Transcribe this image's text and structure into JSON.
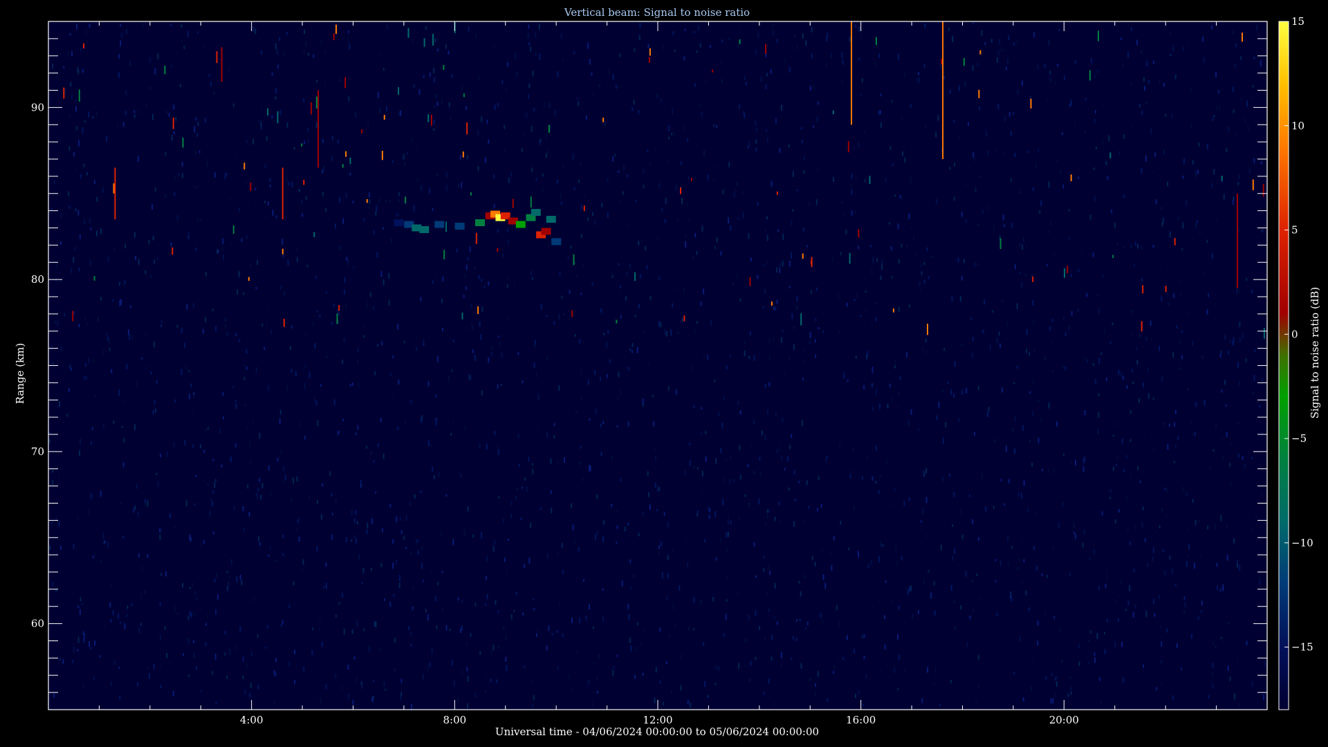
{
  "chart_data": {
    "type": "heatmap",
    "title": "Vertical beam: Signal to noise ratio",
    "xlabel": "Universal time - 04/06/2024 00:00:00 to 05/06/2024 00:00:00",
    "ylabel": "Range (km)",
    "colorbar_label": "Signal to noise ratio (dB)",
    "x_unit": "hours UT",
    "xlim": [
      0,
      24
    ],
    "ylim": [
      55,
      95
    ],
    "clim": [
      -18,
      15
    ],
    "x_ticks": [
      {
        "value": 4,
        "label": "4:00"
      },
      {
        "value": 8,
        "label": "8:00"
      },
      {
        "value": 12,
        "label": "12:00"
      },
      {
        "value": 16,
        "label": "16:00"
      },
      {
        "value": 20,
        "label": "20:00"
      }
    ],
    "y_ticks": [
      {
        "value": 60,
        "label": "60"
      },
      {
        "value": 70,
        "label": "70"
      },
      {
        "value": 80,
        "label": "80"
      },
      {
        "value": 90,
        "label": "90"
      }
    ],
    "colorbar_ticks": [
      {
        "value": 15,
        "label": "15"
      },
      {
        "value": 10,
        "label": "10"
      },
      {
        "value": 5,
        "label": "5"
      },
      {
        "value": 0,
        "label": "0"
      },
      {
        "value": -5,
        "label": "−5"
      },
      {
        "value": -10,
        "label": "−10"
      },
      {
        "value": -15,
        "label": "−15"
      }
    ],
    "background_level_db": -17,
    "colormap": [
      "#000033",
      "#00105a",
      "#003a78",
      "#006a6a",
      "#008040",
      "#00a000",
      "#407000",
      "#a00000",
      "#dd2200",
      "#ff7a00",
      "#ffc000",
      "#ffff40"
    ],
    "echo_layer": {
      "time_range": [
        6.8,
        10.2
      ],
      "range_km": [
        82,
        84.5
      ],
      "cells": [
        {
          "t": 6.9,
          "r": 83.3,
          "v": -14
        },
        {
          "t": 7.1,
          "r": 83.2,
          "v": -12
        },
        {
          "t": 7.25,
          "r": 83.0,
          "v": -8
        },
        {
          "t": 7.4,
          "r": 82.9,
          "v": -10
        },
        {
          "t": 7.7,
          "r": 83.2,
          "v": -13
        },
        {
          "t": 8.1,
          "r": 83.1,
          "v": -12
        },
        {
          "t": 8.5,
          "r": 83.3,
          "v": -6
        },
        {
          "t": 8.7,
          "r": 83.7,
          "v": 4
        },
        {
          "t": 8.8,
          "r": 83.8,
          "v": 9
        },
        {
          "t": 8.9,
          "r": 83.6,
          "v": 14
        },
        {
          "t": 9.0,
          "r": 83.7,
          "v": 7
        },
        {
          "t": 9.15,
          "r": 83.4,
          "v": 3
        },
        {
          "t": 9.3,
          "r": 83.2,
          "v": -4
        },
        {
          "t": 9.5,
          "r": 83.6,
          "v": -5
        },
        {
          "t": 9.6,
          "r": 83.9,
          "v": -8
        },
        {
          "t": 9.7,
          "r": 82.6,
          "v": 5
        },
        {
          "t": 9.8,
          "r": 82.8,
          "v": 3
        },
        {
          "t": 9.9,
          "r": 83.5,
          "v": -10
        },
        {
          "t": 10.0,
          "r": 82.2,
          "v": -12
        }
      ]
    },
    "vertical_streaks": [
      {
        "t": 15.8,
        "r": [
          89,
          95
        ],
        "v": 10
      },
      {
        "t": 17.6,
        "r": [
          87,
          95
        ],
        "v": 9
      },
      {
        "t": 23.4,
        "r": [
          79.5,
          85
        ],
        "v": 3
      },
      {
        "t": 1.3,
        "r": [
          83.5,
          86.5
        ],
        "v": 5
      },
      {
        "t": 4.6,
        "r": [
          83.5,
          86.5
        ],
        "v": 6
      },
      {
        "t": 5.3,
        "r": [
          86.5,
          91
        ],
        "v": 4
      },
      {
        "t": 3.4,
        "r": [
          91.5,
          93.5
        ],
        "v": 2
      }
    ]
  }
}
